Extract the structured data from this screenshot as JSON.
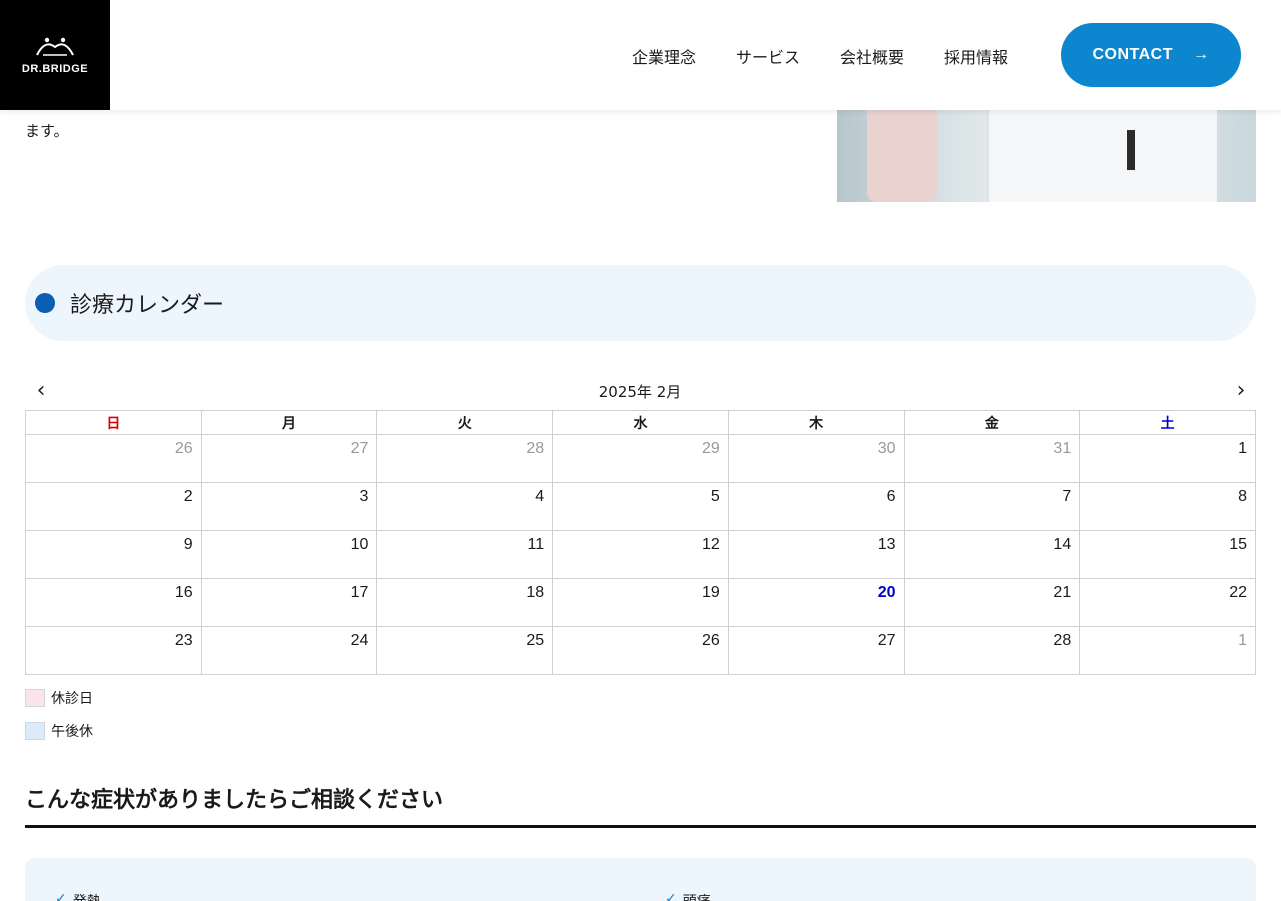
{
  "header": {
    "logo_text": "DR.BRIDGE",
    "nav": [
      "企業理念",
      "サービス",
      "会社概要",
      "採用情報"
    ],
    "contact_label": "CONTACT"
  },
  "intro": {
    "tail_text": "ます。"
  },
  "calendar_section": {
    "title": "診療カレンダー"
  },
  "calendar": {
    "title": "2025年 2月",
    "weekdays": [
      "日",
      "月",
      "火",
      "水",
      "木",
      "金",
      "土"
    ],
    "weeks": [
      [
        "26",
        "27",
        "28",
        "29",
        "30",
        "31",
        "1"
      ],
      [
        "2",
        "3",
        "4",
        "5",
        "6",
        "7",
        "8"
      ],
      [
        "9",
        "10",
        "11",
        "12",
        "13",
        "14",
        "15"
      ],
      [
        "16",
        "17",
        "18",
        "19",
        "20",
        "21",
        "22"
      ],
      [
        "23",
        "24",
        "25",
        "26",
        "27",
        "28",
        "1"
      ]
    ],
    "today": "20"
  },
  "legend": [
    {
      "label": "休診日",
      "color": "#fde3ea"
    },
    {
      "label": "午後休",
      "color": "#dcebfa"
    }
  ],
  "symptoms": {
    "heading": "こんな症状がありましたらご相談ください",
    "items": [
      "発熱",
      "頭痛"
    ]
  },
  "colors": {
    "accent": "#0b86cf",
    "section_bg": "#edf5fd",
    "dot": "#0b5fb3",
    "sunday": "#dd0000",
    "saturday": "#0000c8"
  }
}
